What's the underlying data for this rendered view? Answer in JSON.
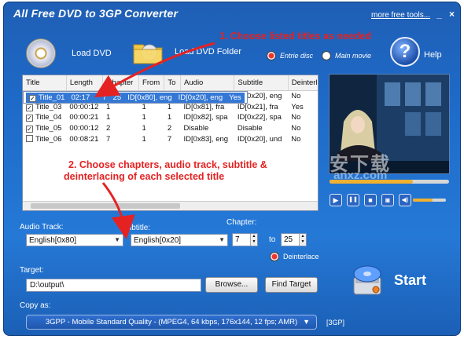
{
  "window": {
    "title": "All Free DVD to 3GP Converter",
    "more_link": "more free tools...",
    "min_symbol": "_",
    "close_symbol": "×"
  },
  "toolbar": {
    "load_dvd": "Load DVD",
    "load_dvd_folder": "Load DVD Folder",
    "entire_disc": "Entrie disc",
    "main_movie": "Main movie",
    "help": "Help",
    "help_symbol": "?"
  },
  "titles": {
    "columns": [
      "Title",
      "Length",
      "Chapter",
      "From",
      "To",
      "Audio",
      "Subtitle",
      "Deinterlace"
    ],
    "rows": [
      {
        "checked": true,
        "title": "Title_01",
        "length": "02:17",
        "chapter": "",
        "from": "7",
        "to": "25",
        "audio": "ID[0x80], eng",
        "subtitle": "ID[0x20], eng",
        "deinterlace": "Yes"
      },
      {
        "checked": false,
        "title": "Title_02",
        "length": "00:00:12",
        "chapter": "1",
        "from": "1",
        "to": "1",
        "audio": "ID[0x80], eng",
        "subtitle": "ID[0x20], eng",
        "deinterlace": "No"
      },
      {
        "checked": true,
        "title": "Title_03",
        "length": "00:00:12",
        "chapter": "1",
        "from": "1",
        "to": "1",
        "audio": "ID[0x81], fra",
        "subtitle": "ID[0x21], fra",
        "deinterlace": "Yes"
      },
      {
        "checked": true,
        "title": "Title_04",
        "length": "00:00:21",
        "chapter": "1",
        "from": "1",
        "to": "1",
        "audio": "ID[0x82], spa",
        "subtitle": "ID[0x22], spa",
        "deinterlace": "No"
      },
      {
        "checked": true,
        "title": "Title_05",
        "length": "00:00:12",
        "chapter": "2",
        "from": "1",
        "to": "2",
        "audio": "Disable",
        "subtitle": "Disable",
        "deinterlace": "No"
      },
      {
        "checked": false,
        "title": "Title_06",
        "length": "00:08:21",
        "chapter": "7",
        "from": "1",
        "to": "7",
        "audio": "ID[0x83], eng",
        "subtitle": "ID[0x20], und",
        "deinterlace": "No"
      }
    ]
  },
  "player": {
    "play": "▶",
    "pause": "❚❚",
    "stop": "■",
    "snapshot": "◙",
    "volume": "◀)",
    "seek_progress": 0.7,
    "volume_level": 0.6
  },
  "settings": {
    "audio_track_label": "Audio Track:",
    "audio_track_value": "English[0x80]",
    "subtitle_label": "Subtitle:",
    "subtitle_value": "English[0x20]",
    "chapter_label": "Chapter:",
    "chapter_from": "7",
    "chapter_to_label": "to",
    "chapter_to": "25",
    "deinterlace": "Deinterlace",
    "target_label": "Target:",
    "target_value": "D:\\output\\",
    "browse": "Browse...",
    "find_target": "Find Target",
    "start": "Start",
    "copy_as_label": "Copy as:",
    "format_value": "3GPP - Mobile Standard Quality - (MPEG4, 64 kbps, 176x144, 12 fps; AMR)",
    "format_tag": "[3GP]"
  },
  "annotations": {
    "step1": "1. Choose listed titles as needed",
    "step2_line1": "2. Choose chapters, audio track, subtitle &",
    "step2_line2": "deinterlacing of each selected title"
  },
  "watermark": {
    "line1": "安下载",
    "line2": "anxz.com"
  },
  "colors": {
    "accent": "#1f63bd",
    "selection": "#3478d6",
    "annotation": "#e52222"
  }
}
